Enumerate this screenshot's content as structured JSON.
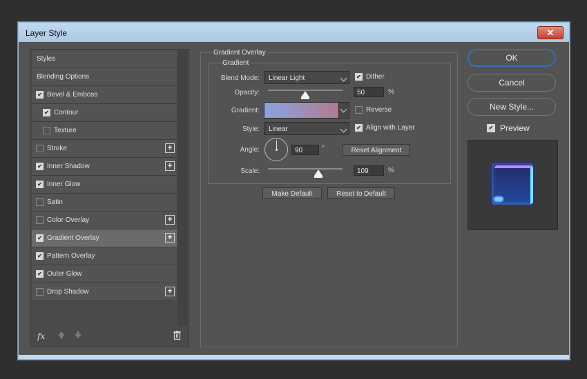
{
  "window": {
    "title": "Layer Style",
    "close_glyph": "✕"
  },
  "styles_list": [
    {
      "label": "Styles",
      "checkbox": null,
      "plus": false,
      "header": true
    },
    {
      "label": "Blending Options",
      "checkbox": null,
      "plus": false,
      "header": true
    },
    {
      "label": "Bevel & Emboss",
      "checkbox": true,
      "plus": false
    },
    {
      "label": "Contour",
      "checkbox": true,
      "plus": false,
      "indent": true
    },
    {
      "label": "Texture",
      "checkbox": false,
      "plus": false,
      "indent": true
    },
    {
      "label": "Stroke",
      "checkbox": false,
      "plus": true
    },
    {
      "label": "Inner Shadow",
      "checkbox": true,
      "plus": true
    },
    {
      "label": "Inner Glow",
      "checkbox": true,
      "plus": false
    },
    {
      "label": "Satin",
      "checkbox": false,
      "plus": false
    },
    {
      "label": "Color Overlay",
      "checkbox": false,
      "plus": true
    },
    {
      "label": "Gradient Overlay",
      "checkbox": true,
      "plus": true,
      "active": true
    },
    {
      "label": "Pattern Overlay",
      "checkbox": true,
      "plus": false
    },
    {
      "label": "Outer Glow",
      "checkbox": true,
      "plus": false
    },
    {
      "label": "Drop Shadow",
      "checkbox": false,
      "plus": true
    }
  ],
  "left_toolbar": {
    "fx": "fx",
    "up_icon": "arrow-up-icon",
    "down_icon": "arrow-down-icon",
    "trash_icon": "trash-icon"
  },
  "gradient_overlay": {
    "section_title": "Gradient Overlay",
    "group_title": "Gradient",
    "blend_mode_label": "Blend Mode:",
    "blend_mode_value": "Linear Light",
    "dither_label": "Dither",
    "dither_checked": true,
    "opacity_label": "Opacity:",
    "opacity_value": "50",
    "opacity_unit": "%",
    "opacity_level": 0.5,
    "gradient_label": "Gradient:",
    "gradient_colors": [
      "#8aa4e0",
      "#b07a8f"
    ],
    "reverse_label": "Reverse",
    "reverse_checked": false,
    "style_label": "Style:",
    "style_value": "Linear",
    "align_label": "Align with Layer",
    "align_checked": true,
    "angle_label": "Angle:",
    "angle_value": "90",
    "angle_unit": "°",
    "reset_alignment_label": "Reset Alignment",
    "scale_label": "Scale:",
    "scale_value": "109",
    "scale_unit": "%",
    "scale_level": 0.6,
    "make_default_label": "Make Default",
    "reset_default_label": "Reset to Default"
  },
  "actions": {
    "ok": "OK",
    "cancel": "Cancel",
    "new_style": "New Style...",
    "preview": "Preview",
    "preview_checked": true
  },
  "colors": {
    "dialog_bg": "#535353",
    "accent": "#3a6fb5",
    "titlebar": "#c1d9ef"
  }
}
